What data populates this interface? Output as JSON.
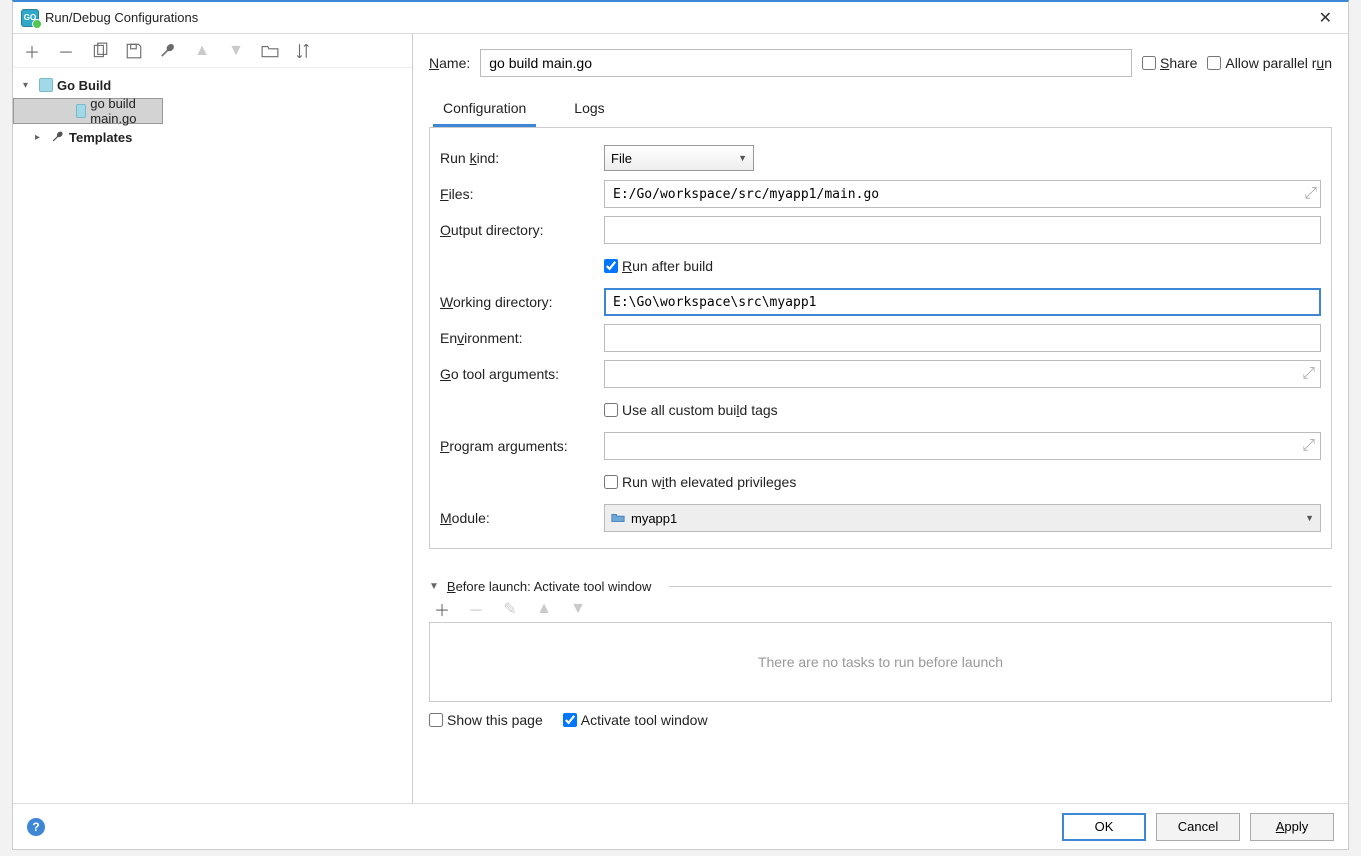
{
  "window": {
    "title": "Run/Debug Configurations"
  },
  "toolbar_icons": [
    "add",
    "remove",
    "copy",
    "save",
    "edit",
    "up",
    "down",
    "folder",
    "sort"
  ],
  "tree": {
    "group": "Go Build",
    "config_item": "go build main.go",
    "templates": "Templates"
  },
  "right": {
    "name_label": "Name:",
    "name_value": "go build main.go",
    "share_label": "Share",
    "parallel_label": "Allow parallel run",
    "tabs": {
      "configuration": "Configuration",
      "logs": "Logs"
    },
    "form": {
      "run_kind_label": "Run kind:",
      "run_kind_value": "File",
      "files_label": "Files:",
      "files_value": "E:/Go/workspace/src/myapp1/main.go",
      "output_dir_label": "Output directory:",
      "output_dir_value": "",
      "run_after_build_label": "Run after build",
      "run_after_build_checked": true,
      "working_dir_label": "Working directory:",
      "working_dir_value": "E:\\Go\\workspace\\src\\myapp1",
      "env_label": "Environment:",
      "env_value": "",
      "go_args_label": "Go tool arguments:",
      "go_args_value": "",
      "custom_tags_label": "Use all custom build tags",
      "program_args_label": "Program arguments:",
      "program_args_value": "",
      "elevated_label": "Run with elevated privileges",
      "module_label": "Module:",
      "module_value": "myapp1"
    },
    "before_launch": {
      "header": "Before launch: Activate tool window",
      "empty": "There are no tasks to run before launch",
      "show_this_page": "Show this page",
      "activate_tool_window": "Activate tool window",
      "activate_checked": true
    }
  },
  "footer": {
    "ok": "OK",
    "cancel": "Cancel",
    "apply": "Apply"
  }
}
